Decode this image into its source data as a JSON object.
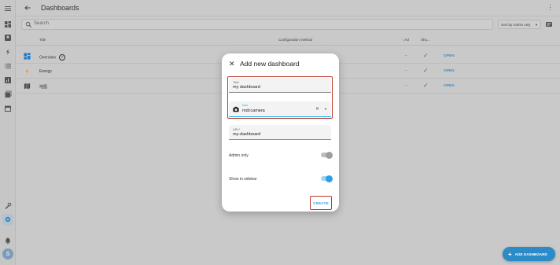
{
  "header": {
    "title": "Dashboards",
    "more_icon": "⋮"
  },
  "search": {
    "placeholder": "Search"
  },
  "sort": {
    "label": "Sort by Admin only"
  },
  "table": {
    "columns": {
      "title": "Title",
      "configuration": "Configuration method",
      "admin": "Ad",
      "show": "Sho..."
    },
    "rows": [
      {
        "title": "Overview",
        "icon": "dashboard-icon",
        "icon_color": "#1f78c8",
        "admin": "–",
        "show": "✓",
        "action": "OPEN"
      },
      {
        "title": "Energy",
        "icon": "lightning-icon",
        "icon_color": "#f19c2b",
        "admin": "–",
        "show": "✓",
        "action": "OPEN"
      },
      {
        "title": "地图",
        "icon": "map-icon",
        "icon_color": "#444444",
        "admin": "–",
        "show": "✓",
        "action": "OPEN"
      }
    ]
  },
  "dialog": {
    "close": "✕",
    "title": "Add new dashboard",
    "title_field": {
      "label": "Title*",
      "value": "my dashboard"
    },
    "icon_field": {
      "label": "Icon",
      "value": "mdi:camera"
    },
    "url_field": {
      "label": "URL*",
      "value": "my-dashboard"
    },
    "admin_only_label": "Admin only",
    "admin_only_on": false,
    "show_sidebar_label": "Show in sidebar",
    "show_sidebar_on": true,
    "create_label": "CREATE"
  },
  "fab": {
    "label": "ADD DASHBOARD"
  },
  "user": {
    "avatar_letter": "S"
  },
  "colors": {
    "accent": "#03a9f4",
    "highlight": "#c0392b",
    "primary": "#2b8ac8"
  }
}
